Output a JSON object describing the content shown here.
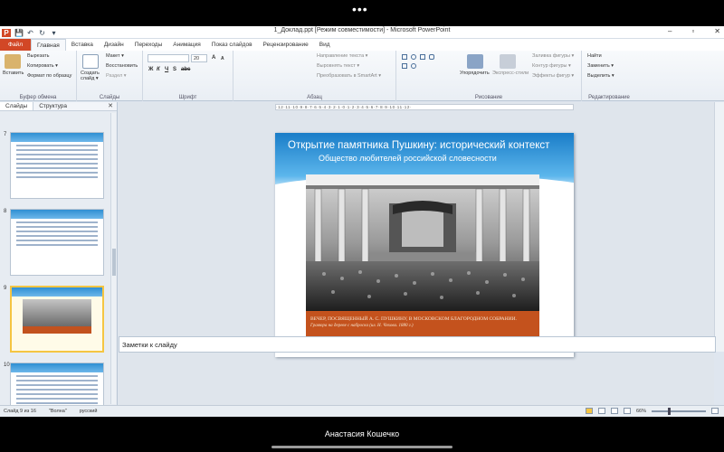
{
  "device": {
    "dots": "•••",
    "presenter_name": "Анастасия Кошечко"
  },
  "window": {
    "title": "1_Доклад.ppt [Режим совместимости] - Microsoft PowerPoint",
    "qat": [
      "P",
      "💾",
      "↶",
      "↻",
      "▾"
    ],
    "controls": [
      "–",
      "▫",
      "✕"
    ]
  },
  "tabs": [
    "Файл",
    "Главная",
    "Вставка",
    "Дизайн",
    "Переходы",
    "Анимация",
    "Показ слайдов",
    "Рецензирование",
    "Вид"
  ],
  "ribbon": {
    "clipboard": {
      "paste": "Вставить",
      "cut": "Вырезать",
      "copy": "Копировать ▾",
      "format": "Формат по образцу",
      "label": "Буфер обмена"
    },
    "slides": {
      "new": "Создать слайд ▾",
      "layout": "Макет ▾",
      "reset": "Восстановить",
      "section": "Раздел ▾",
      "label": "Слайды"
    },
    "font": {
      "name": "",
      "size": "20",
      "grow": "A",
      "shrink": "A",
      "b": "Ж",
      "i": "К",
      "u": "Ч",
      "s": "S",
      "abc": "abc",
      "label": "Шрифт"
    },
    "paragraph": {
      "dir": "Направление текста ▾",
      "align": "Выровнять текст ▾",
      "smart": "Преобразовать в SmartArt ▾",
      "label": "Абзац"
    },
    "drawing": {
      "arrange": "Упорядочить",
      "styles": "Экспресс-стили",
      "fill": "Заливка фигуры ▾",
      "outline": "Контур фигуры ▾",
      "effects": "Эффекты фигур ▾",
      "label": "Рисование"
    },
    "editing": {
      "find": "Найти",
      "replace": "Заменить ▾",
      "select": "Выделить ▾",
      "label": "Редактирование"
    }
  },
  "panel": {
    "tab_slides": "Слайды",
    "tab_outline": "Структура",
    "close": "✕",
    "thumbs": [
      "7",
      "8",
      "9",
      "10"
    ]
  },
  "ruler": "·12·11·10·9·8·7·6·5·4·3·2·1·0·1·2·3·4·5·6·7·8·9·10·11·12·",
  "slide": {
    "title": "Открытие памятника Пушкину: исторический контекст",
    "subtitle": "Общество любителей российской словесности",
    "caption_line1": "ВЕЧЕР, ПОСВЯЩЕННЫЙ А. С. ПУШКИНУ, В МОСКОВСКОМ БЛАГОРОДНОМ СОБРАНИИ.",
    "caption_line2": "Гравюра на дереве с наброска (ил. Н. Чехова. 1880 г.)"
  },
  "notes": {
    "placeholder": "Заметки к слайду"
  },
  "status": {
    "slide": "Слайд 9 из 16",
    "theme": "\"Волна\"",
    "lang": "русский",
    "zoom": "66%"
  }
}
